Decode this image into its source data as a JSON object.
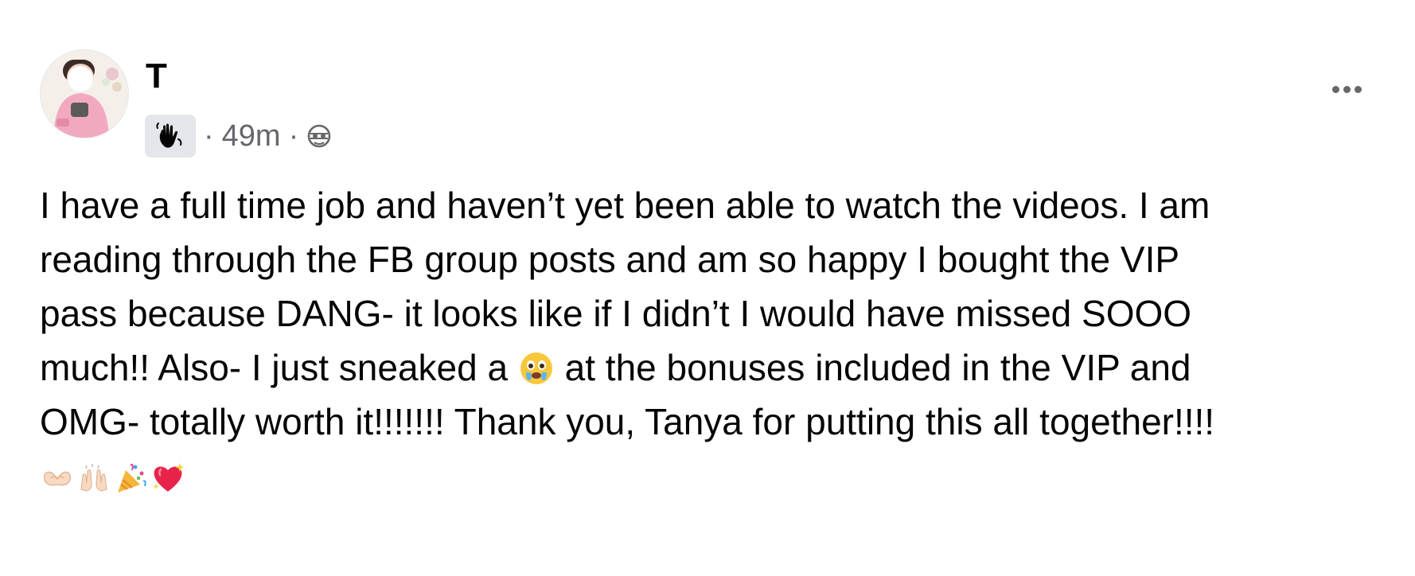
{
  "post": {
    "author_name": "T",
    "time": "49m",
    "separator": "·",
    "privacy_icon": "globe-icon",
    "badge_icon": "waving-hand-icon",
    "more_icon": "more-options-icon",
    "text_lines": [
      "I have a full time job and haven’t yet been able to watch the videos. I am",
      "reading through the FB group posts and am so happy I bought the VIP",
      "pass because DANG- it looks like if I didn’t I would have missed SOOO",
      "much!! Also- I just sneaked a",
      " at the bonuses included in the VIP and",
      "OMG- totally worth it!!!!!!! Thank you, Tanya for putting this all together!!!!"
    ],
    "inline_emoji": "crying-face-emoji",
    "trailing_emojis": [
      "heart-hands-emoji",
      "raising-hands-emoji",
      "party-popper-emoji",
      "sparkling-heart-emoji"
    ]
  },
  "colors": {
    "text": "#050505",
    "secondary_text": "#65676b",
    "badge_bg": "#e4e6eb"
  }
}
